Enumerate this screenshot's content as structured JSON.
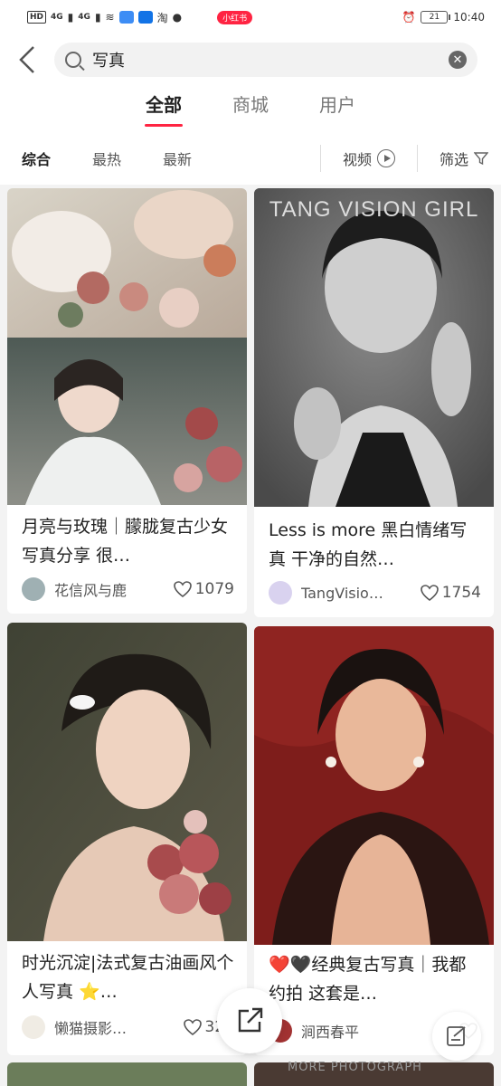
{
  "status_bar": {
    "network_tags": [
      "HD",
      "4G",
      "4G"
    ],
    "app_badge": "小红书",
    "battery": "21",
    "time": "10:40"
  },
  "search": {
    "query": "写真",
    "clear_icon": "clear-icon"
  },
  "tabs": [
    {
      "label": "全部",
      "active": true
    },
    {
      "label": "商城",
      "active": false
    },
    {
      "label": "用户",
      "active": false
    }
  ],
  "filters": {
    "sort": [
      {
        "label": "综合",
        "active": true
      },
      {
        "label": "最热",
        "active": false
      },
      {
        "label": "最新",
        "active": false
      }
    ],
    "video_label": "视频",
    "filter_label": "筛选"
  },
  "feed": [
    {
      "title": "月亮与玫瑰｜朦胧复古少女写真分享 很…",
      "author": "花信风与鹿",
      "likes": "1079"
    },
    {
      "title": "Less is more 黑白情绪写真 干净的自然…",
      "author": "TangVisio…",
      "likes": "1754",
      "image_text": "TANG VISION GIRL"
    },
    {
      "title": "时光沉淀|法式复古油画风个人写真 ⭐…",
      "author": "懒猫摄影…",
      "likes": "324"
    },
    {
      "title": "❤️🖤经典复古写真｜我都约拍 这套是…",
      "author": "涧西春平",
      "likes": ""
    }
  ],
  "watermark": "MORE PHOTOGRAPH",
  "colors": {
    "accent": "#ff2442",
    "background": "#f3f3f3"
  }
}
